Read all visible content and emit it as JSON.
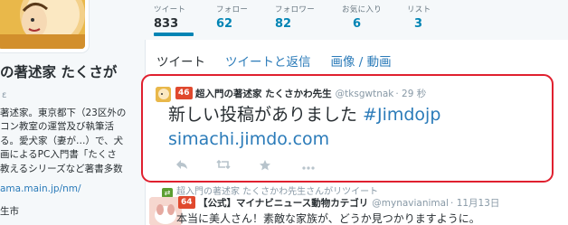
{
  "profile": {
    "name": "の著述家 たくさが",
    "bio_lines": [
      "著述家。東京都下（23区外の",
      "コン教室の運営及び執筆活",
      "る。愛犬家（妻が…）で、犬",
      "画によるPC入門書「たくさ",
      "教えるシリーズなど著書多数"
    ],
    "link": "ama.main.jp/nm/",
    "location": "生市"
  },
  "stats": [
    {
      "label": "ツイート",
      "value": "833"
    },
    {
      "label": "フォロー",
      "value": "62"
    },
    {
      "label": "フォロワー",
      "value": "82"
    },
    {
      "label": "お気に入り",
      "value": "6"
    },
    {
      "label": "リスト",
      "value": "3"
    }
  ],
  "tabs": [
    {
      "label": "ツイート"
    },
    {
      "label": "ツイートと返信"
    },
    {
      "label": "画像 / 動画"
    }
  ],
  "new_tweet": {
    "badge": "46",
    "author": "超入門の著述家 たくさかわ先生",
    "handle": "@tksgwtnak",
    "time": "· 29 秒",
    "text_plain": "新しい投稿がありました ",
    "hashtag": "#Jimdojp",
    "url": "simachi.jimdo.com"
  },
  "retweet": {
    "note": "超入門の著述家 たくさかわ先生さんがリツイート",
    "badge": "64",
    "author": "【公式】マイナビニュース動物カテゴリ",
    "handle": "@mynavianimal",
    "time": "· 11月13日",
    "text": "本当に美人さん！素敵な家族が、どうか見つかりますように。"
  },
  "colors": {
    "accent": "#0084b4",
    "highlight_border": "#e0202f",
    "badge": "#e0492e"
  }
}
